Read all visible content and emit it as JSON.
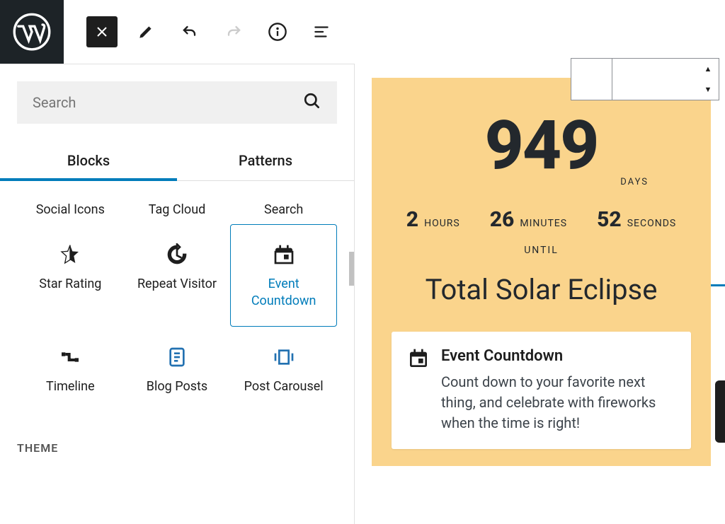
{
  "search": {
    "placeholder": "Search"
  },
  "tabs": {
    "blocks": "Blocks",
    "patterns": "Patterns"
  },
  "blocks_row1": [
    {
      "label": "Social Icons"
    },
    {
      "label": "Tag Cloud"
    },
    {
      "label": "Search"
    }
  ],
  "blocks_row2": [
    {
      "label": "Star Rating"
    },
    {
      "label": "Repeat Visitor"
    },
    {
      "label": "Event Countdown"
    }
  ],
  "blocks_row3": [
    {
      "label": "Timeline"
    },
    {
      "label": "Blog Posts"
    },
    {
      "label": "Post Carousel"
    }
  ],
  "theme_section": "THEME",
  "preview": {
    "days_num": "949",
    "days_label": "DAYS",
    "hours_num": "2",
    "hours_label": "HOURS",
    "minutes_num": "26",
    "minutes_label": "MINUTES",
    "seconds_num": "52",
    "seconds_label": "SECONDS",
    "until": "UNTIL",
    "event_title": "Total Solar Eclipse"
  },
  "desc": {
    "title": "Event Countdown",
    "text": "Count down to your favorite next thing, and celebrate with fireworks when the time is right!"
  }
}
